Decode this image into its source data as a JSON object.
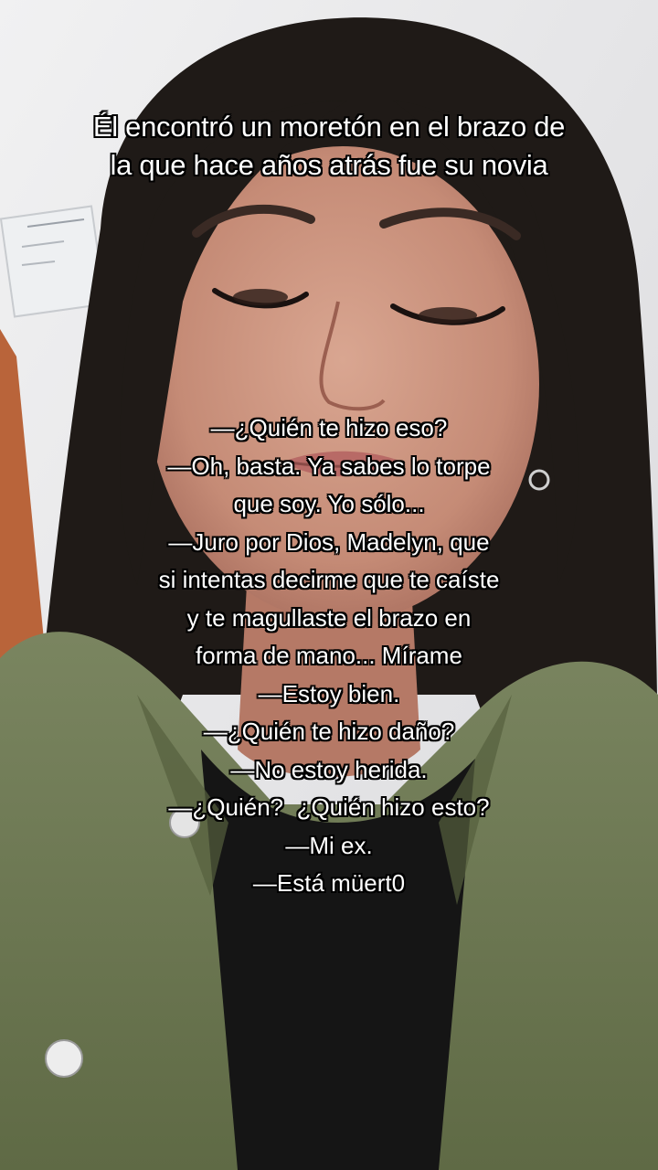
{
  "top_caption": {
    "line1": "Él encontró un moretón en el brazo de",
    "line2": "la que hace años atrás fue su novia"
  },
  "dialogue": [
    "—¿Quién te hizo eso?",
    "—Oh, basta. Ya sabes lo torpe",
    "que soy. Yo sólo...",
    "—Juro por Dios, Madelyn, que",
    "si intentas decirme que te caíste",
    "y te magullaste el brazo en",
    "forma de mano... Mírame",
    "—Estoy bien.",
    "—¿Quién te hizo daño?",
    "—No estoy herida.",
    "—¿Quién?  ¿Quién hizo esto?",
    "—Mi ex.",
    "—Está müert0"
  ],
  "colors": {
    "caption_text": "#ffffff",
    "caption_outline": "#000000",
    "jacket": "#6f7a52",
    "hair": "#1f1a17",
    "wall": "#e9e9ea",
    "door": "#b9643a"
  }
}
